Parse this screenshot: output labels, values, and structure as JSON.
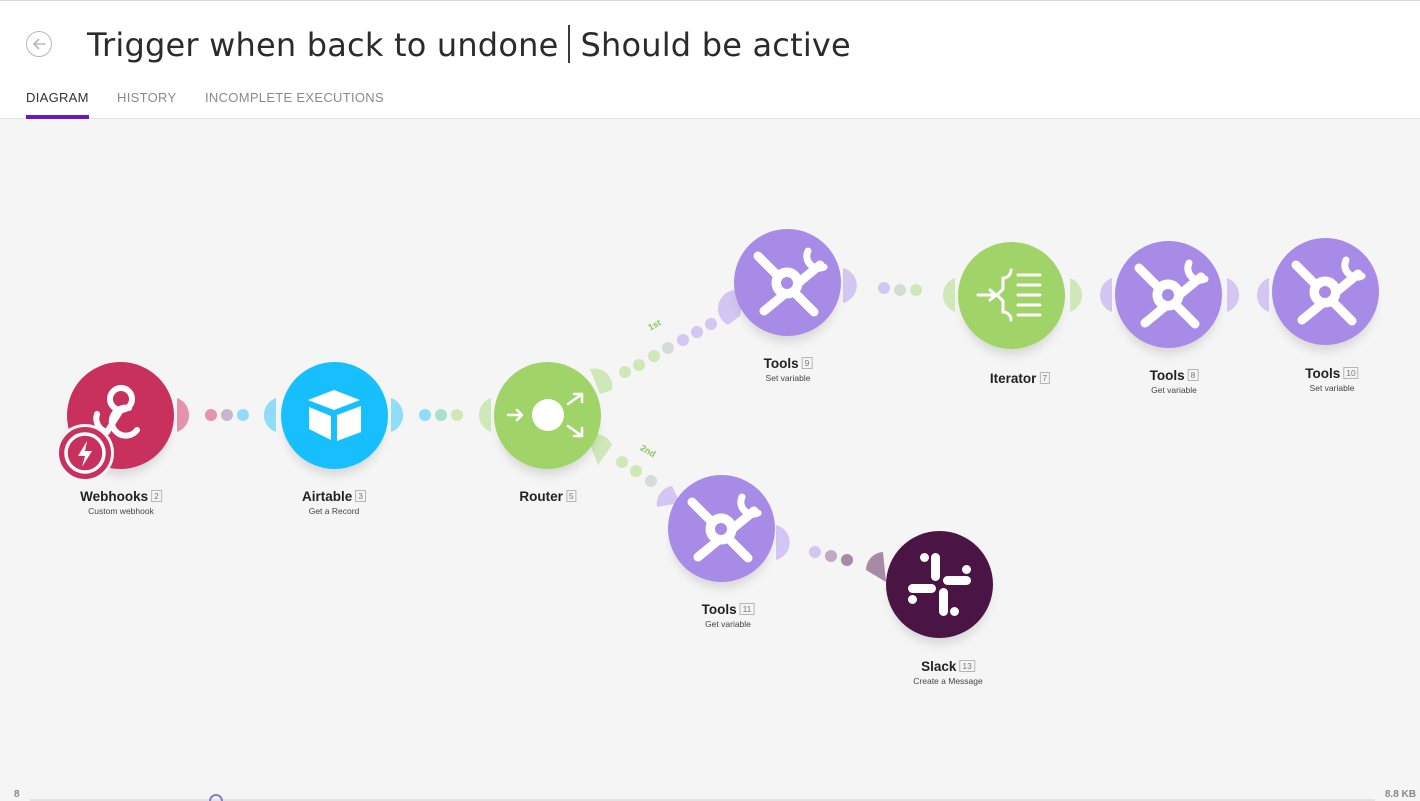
{
  "header": {
    "title_left": "Trigger when back to undone",
    "title_right": "Should be active",
    "back_icon": "arrow-left-circle-icon"
  },
  "tabs": [
    {
      "label": "DIAGRAM",
      "active": true
    },
    {
      "label": "HISTORY",
      "active": false
    },
    {
      "label": "INCOMPLETE EXECUTIONS",
      "active": false
    }
  ],
  "colors": {
    "accent": "#6b17c6",
    "webhooks": "#c8305e",
    "airtable": "#18bfff",
    "router": "#a0d468",
    "tools": "#a88be6",
    "iterator": "#a0d468",
    "slack": "#4a1445"
  },
  "modules": [
    {
      "id": "webhooks",
      "name": "Webhooks",
      "num": "2",
      "desc": "Custom webhook",
      "icon": "webhook-icon"
    },
    {
      "id": "airtable",
      "name": "Airtable",
      "num": "3",
      "desc": "Get a Record",
      "icon": "airtable-icon"
    },
    {
      "id": "router",
      "name": "Router",
      "num": "5",
      "desc": "",
      "icon": "router-icon"
    },
    {
      "id": "tools9",
      "name": "Tools",
      "num": "9",
      "desc": "Set variable",
      "icon": "tools-icon"
    },
    {
      "id": "iterator",
      "name": "Iterator",
      "num": "7",
      "desc": "",
      "icon": "iterator-icon"
    },
    {
      "id": "tools8",
      "name": "Tools",
      "num": "8",
      "desc": "Get variable",
      "icon": "tools-icon"
    },
    {
      "id": "tools10",
      "name": "Tools",
      "num": "10",
      "desc": "Set variable",
      "icon": "tools-icon"
    },
    {
      "id": "tools11",
      "name": "Tools",
      "num": "11",
      "desc": "Get variable",
      "icon": "tools-icon"
    },
    {
      "id": "slack",
      "name": "Slack",
      "num": "13",
      "desc": "Create a Message",
      "icon": "slack-icon"
    }
  ],
  "routes": [
    {
      "label": "1st"
    },
    {
      "label": "2nd"
    }
  ],
  "footer": {
    "left": "8",
    "right": "8.8 KB"
  }
}
